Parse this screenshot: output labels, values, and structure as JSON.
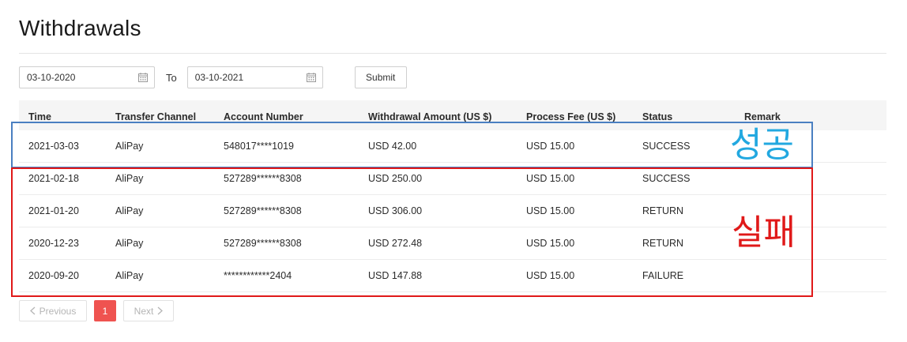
{
  "page": {
    "title": "Withdrawals"
  },
  "filters": {
    "from_value": "03-10-2020",
    "to_label": "To",
    "to_value": "03-10-2021",
    "submit_label": "Submit"
  },
  "table": {
    "columns": [
      "Time",
      "Transfer Channel",
      "Account Number",
      "Withdrawal Amount (US $)",
      "Process Fee (US $)",
      "Status",
      "Remark"
    ],
    "rows": [
      [
        "2021-03-03",
        "AliPay",
        "548017****1019",
        "USD 42.00",
        "USD 15.00",
        "SUCCESS",
        ""
      ],
      [
        "2021-02-18",
        "AliPay",
        "527289******8308",
        "USD 250.00",
        "USD 15.00",
        "SUCCESS",
        ""
      ],
      [
        "2021-01-20",
        "AliPay",
        "527289******8308",
        "USD 306.00",
        "USD 15.00",
        "RETURN",
        ""
      ],
      [
        "2020-12-23",
        "AliPay",
        "527289******8308",
        "USD 272.48",
        "USD 15.00",
        "RETURN",
        ""
      ],
      [
        "2020-09-20",
        "AliPay",
        "************2404",
        "USD 147.88",
        "USD 15.00",
        "FAILURE",
        ""
      ]
    ]
  },
  "pagination": {
    "prev_label": "Previous",
    "current_page": "1",
    "next_label": "Next"
  },
  "annotations": {
    "success_text": "성공",
    "fail_text": "실패",
    "success_color": "#22a8e0",
    "fail_color": "#e01919",
    "success_box_color": "#4a7fc1",
    "fail_box_color": "#e01919"
  },
  "colors": {
    "active_page": "#ef5350",
    "header_bg": "#f5f5f5"
  }
}
